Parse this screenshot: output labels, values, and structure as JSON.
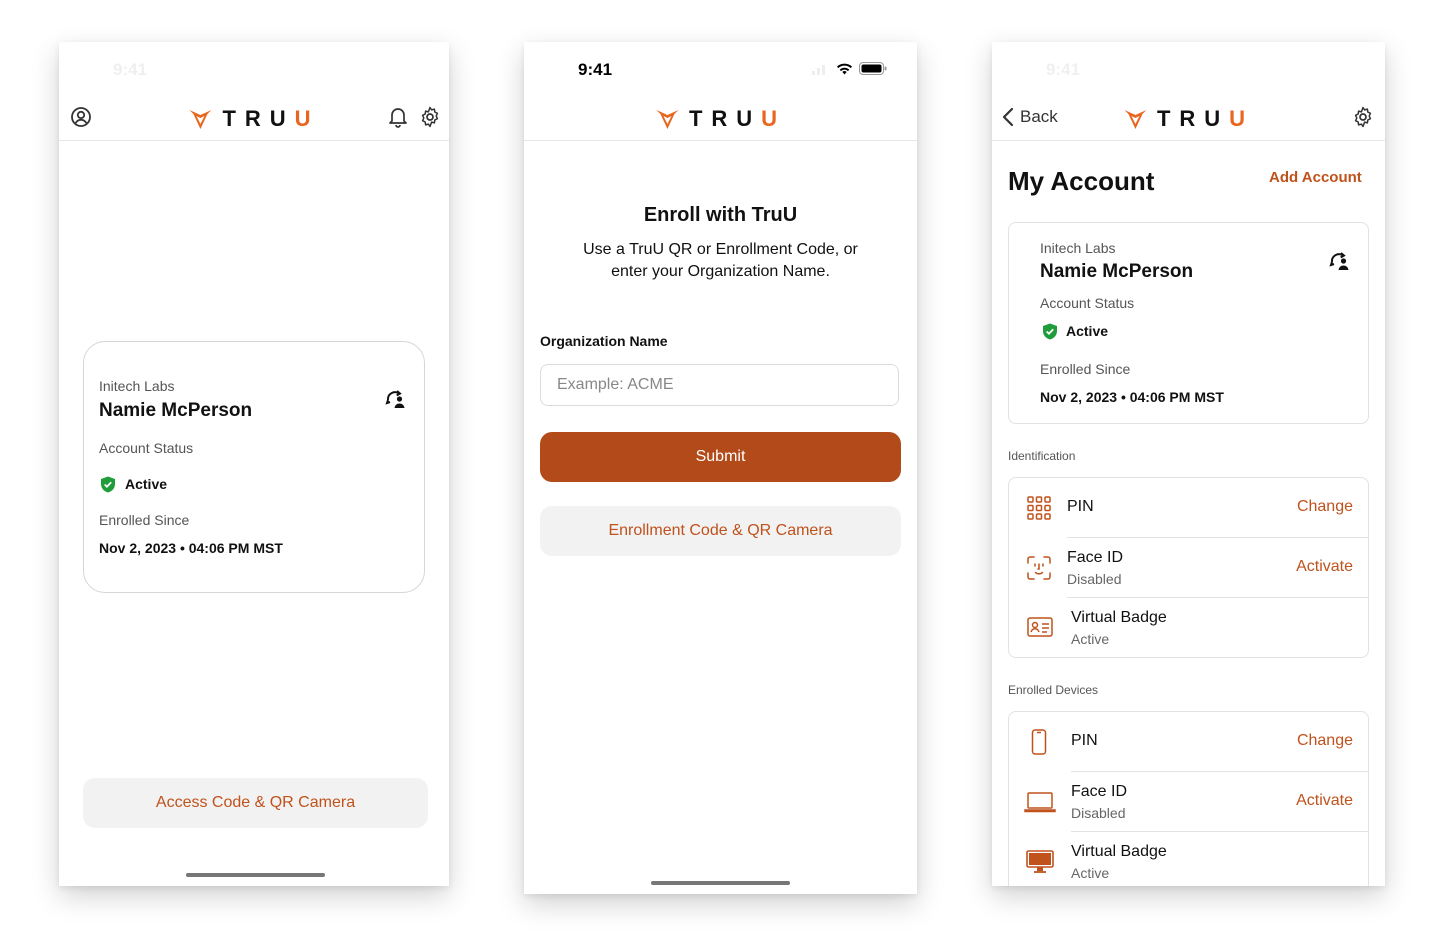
{
  "brand": {
    "logo_text": "TRUU",
    "accent": "#e8661f",
    "primary_button": "#b34a1a",
    "link_color": "#c0521c",
    "active_color": "#1f9d3a"
  },
  "status": {
    "time": "9:41"
  },
  "screen1": {
    "card": {
      "org": "Initech Labs",
      "name": "Namie McPerson",
      "status_label": "Account Status",
      "status_value": "Active",
      "enrolled_label": "Enrolled Since",
      "enrolled_value": "Nov 2, 2023 • 04:06 PM MST"
    },
    "camera_button": "Access Code & QR Camera"
  },
  "screen2": {
    "title": "Enroll with TruU",
    "subtitle_line1": "Use a TruU QR or Enrollment Code, or",
    "subtitle_line2": "enter your Organization Name.",
    "org_label": "Organization Name",
    "org_placeholder": "Example: ACME",
    "submit_label": "Submit",
    "camera_button": "Enrollment Code & QR Camera"
  },
  "screen3": {
    "back_label": "Back",
    "title": "My Account",
    "add_account": "Add Account",
    "card": {
      "org": "Initech Labs",
      "name": "Namie McPerson",
      "status_label": "Account Status",
      "status_value": "Active",
      "enrolled_label": "Enrolled Since",
      "enrolled_value": "Nov 2, 2023 • 04:06 PM MST"
    },
    "identification": {
      "header": "Identification",
      "items": [
        {
          "title": "PIN",
          "sub": "",
          "action": "Change",
          "icon": "keypad-icon"
        },
        {
          "title": "Face ID",
          "sub": "Disabled",
          "action": "Activate",
          "icon": "face-id-icon"
        },
        {
          "title": "Virtual Badge",
          "sub": "Active",
          "action": "",
          "icon": "badge-icon"
        }
      ]
    },
    "devices": {
      "header": "Enrolled Devices",
      "items": [
        {
          "title": "PIN",
          "sub": "",
          "action": "Change",
          "icon": "phone-icon"
        },
        {
          "title": "Face ID",
          "sub": "Disabled",
          "action": "Activate",
          "icon": "laptop-icon"
        },
        {
          "title": "Virtual Badge",
          "sub": "Active",
          "action": "",
          "icon": "desktop-icon"
        }
      ]
    }
  }
}
